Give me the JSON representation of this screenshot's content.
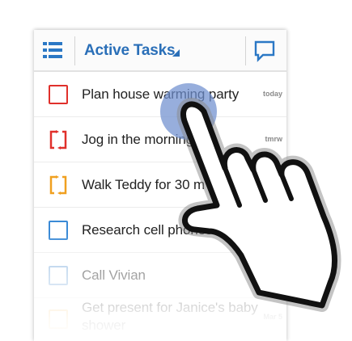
{
  "actionbar": {
    "title": "Active Tasks",
    "menu_icon": "list-menu-icon",
    "comment_icon": "comment-bubble-icon",
    "accent_color": "#2a6fb8"
  },
  "tasks": [
    {
      "label": "Plan house warming party",
      "due": "today",
      "checkbox": "plain",
      "color": "#e0302b"
    },
    {
      "label": "Jog in the morning",
      "due": "tmrw",
      "checkbox": "repeat",
      "color": "#e0302b"
    },
    {
      "label": "Walk Teddy for 30 m",
      "due": "",
      "checkbox": "repeat",
      "color": "#f0a020"
    },
    {
      "label": "Research cell phones",
      "due": "",
      "checkbox": "plain",
      "color": "#3a8ad6"
    },
    {
      "label": "Call Vivian",
      "due": "",
      "checkbox": "plain",
      "color": "#8fb8e0"
    },
    {
      "label": "Get present for Janice's baby shower",
      "due": "Mar 5",
      "checkbox": "plain",
      "color": "#f6c875"
    }
  ],
  "overlay": {
    "hand_icon": "pointing-hand-icon",
    "touch_icon": "touch-point-icon",
    "touch_color": "#6f8fcf"
  }
}
